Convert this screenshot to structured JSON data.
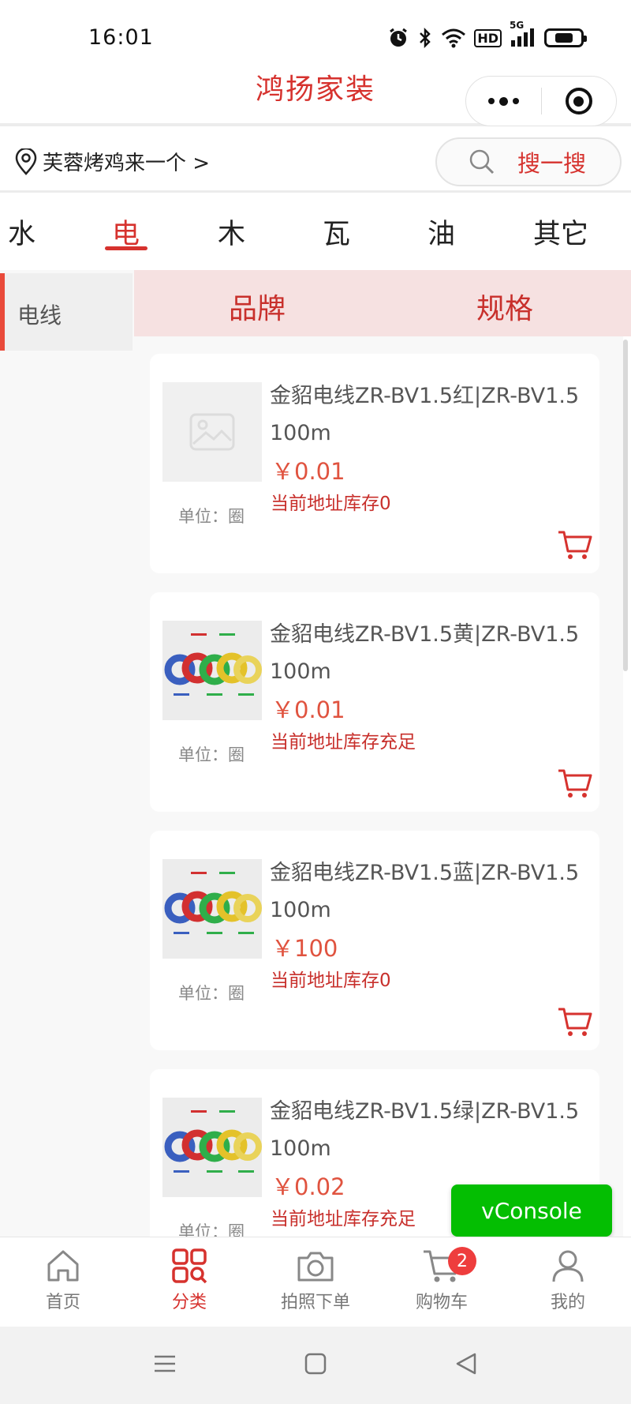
{
  "status_bar": {
    "time": "16:01",
    "network": "5G",
    "hd": "HD"
  },
  "title_bar": {
    "title": "鸿扬家装"
  },
  "location": {
    "text": "芙蓉烤鸡来一个 >"
  },
  "search": {
    "label": "搜一搜"
  },
  "category_tabs": [
    {
      "label": "水",
      "active": false
    },
    {
      "label": "电",
      "active": true
    },
    {
      "label": "木",
      "active": false
    },
    {
      "label": "瓦",
      "active": false
    },
    {
      "label": "油",
      "active": false
    },
    {
      "label": "其它",
      "active": false
    }
  ],
  "side_nav": {
    "items": [
      {
        "label": "电线",
        "active": true
      }
    ]
  },
  "filters": {
    "brand": "品牌",
    "spec": "规格"
  },
  "products": [
    {
      "name": "金貂电线ZR-BV1.5红|ZR-BV1.5 100m",
      "price": "￥0.01",
      "stock": "当前地址库存0",
      "unit": "单位：圈",
      "image": "placeholder-image"
    },
    {
      "name": "金貂电线ZR-BV1.5黄|ZR-BV1.5 100m",
      "price": "￥0.01",
      "stock": "当前地址库存充足",
      "unit": "单位：圈",
      "image": "wire-coils"
    },
    {
      "name": "金貂电线ZR-BV1.5蓝|ZR-BV1.5 100m",
      "price": "￥100",
      "stock": "当前地址库存0",
      "unit": "单位：圈",
      "image": "wire-coils"
    },
    {
      "name": "金貂电线ZR-BV1.5绿|ZR-BV1.5 100m",
      "price": "￥0.02",
      "stock": "当前地址库存充足",
      "unit": "单位：圈",
      "image": "wire-coils"
    }
  ],
  "vconsole": {
    "label": "vConsole"
  },
  "tab_bar": {
    "items": [
      {
        "label": "首页",
        "icon": "home-icon"
      },
      {
        "label": "分类",
        "icon": "category-icon",
        "active": true
      },
      {
        "label": "拍照下单",
        "icon": "camera-icon"
      },
      {
        "label": "购物车",
        "icon": "cart-icon",
        "badge": "2"
      },
      {
        "label": "我的",
        "icon": "user-icon"
      }
    ]
  },
  "colors": {
    "brand": "#d6322e",
    "price": "#e0533f",
    "vconsole": "#04be02",
    "filter_bg": "#f6e1e1"
  }
}
